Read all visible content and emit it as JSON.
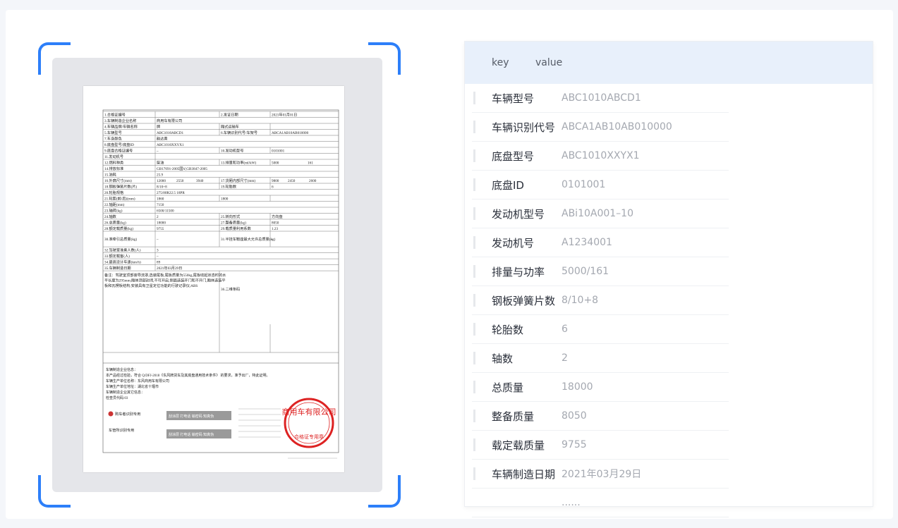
{
  "panel": {
    "header": {
      "key": "key",
      "value": "value"
    },
    "rows": [
      {
        "key": "车辆型号",
        "value": "ABC1010ABCD1"
      },
      {
        "key": "车辆识别代号",
        "value": "ABCA1AB10AB010000"
      },
      {
        "key": "底盘型号",
        "value": "ABC1010XXYX1"
      },
      {
        "key": "底盘ID",
        "value": "0101001"
      },
      {
        "key": "发动机型号",
        "value": "ABi10A001–10"
      },
      {
        "key": "发动机号",
        "value": "A1234001"
      },
      {
        "key": "排量与功率",
        "value": "5000/161"
      },
      {
        "key": "钢板弹簧片数",
        "value": "8/10+8"
      },
      {
        "key": "轮胎数",
        "value": "6"
      },
      {
        "key": "轴数",
        "value": "2"
      },
      {
        "key": "总质量",
        "value": "18000"
      },
      {
        "key": "整备质量",
        "value": "8050"
      },
      {
        "key": "载定载质量",
        "value": "9755"
      },
      {
        "key": "车辆制造日期",
        "value": "2021年03月29日"
      },
      {
        "key": "",
        "value": "......"
      }
    ]
  },
  "document": {
    "cells": {
      "r1a": "1.合格证编号",
      "r1c": "2.发证日期",
      "r1d": "2021年01月01日",
      "r2a": "3.车辆制造企业名称",
      "r2b": "商用车有限公司",
      "r3a": "4.车辆品牌/车辆名称",
      "r3b": "牌",
      "r3c": "厢式运输车",
      "r4a": "5.车辆型号",
      "r4b": "ABC1010ABCD1",
      "r4c": "6.车辆识别代号/车架号",
      "r4d": "ABCA1AB10AB010000",
      "r5a": "7.车身颜色",
      "r5b": "韵达黄",
      "r6a": "8.底盘型号/底盘ID",
      "r6b": "ABC1010XXYX1",
      "r7a": "9.底盘合格证编号",
      "r7b": "–",
      "r7c": "10.发动机型号",
      "r7d": "0101001",
      "r8a": "11.发动机号",
      "r9a": "12.燃料种类",
      "r9b": "柴油",
      "r9c": "13.排量和功率(ml/kW)",
      "r9d": "5000",
      "r9e": "161",
      "r10a": "14.排放标准",
      "r10b": "GB17691-2005国Ⅴ,GB3847-2005",
      "r11a": "15.油耗",
      "r11b": "25.9",
      "r12a": "16.外廓尺寸(mm)",
      "r12b": "12000",
      "r12c": "2550",
      "r12d": "3940",
      "r12e": "17.货厢内部尺寸(mm)",
      "r12f": "9800",
      "r12g": "2450",
      "r12h": "2600",
      "r13a": "18.钢板弹簧片数(片)",
      "r13b": "8/10+8",
      "r13c": "19.轮胎数",
      "r13d": "6",
      "r14a": "20.轮胎规格",
      "r14b": "275/80R22.5 18PR",
      "r15a": "21.轮距(前/后)(mm)",
      "r15b": "1860",
      "r15c": "1800",
      "r16a": "22.轴距(mm)",
      "r16b": "7150",
      "r17a": "23.轴荷(kg)",
      "r17b": "6500/11500",
      "r18a": "24.轴数",
      "r18b": "2",
      "r18c": "25.转向形式",
      "r18d": "方向盘",
      "r19a": "26.总质量(kg)",
      "r19b": "18000",
      "r19c": "27.整备质量(kg)",
      "r19d": "8050",
      "r20a": "28.额定载质量(kg)",
      "r20b": "9755",
      "r20c": "29.载质量利用系数",
      "r20d": "1.23",
      "r21a": "30.准牵引总质量(kg)",
      "r21b": "–",
      "r21c": "31.半挂车鞍座最大允许总质量(kg)",
      "r21d": "–",
      "r22a": "32.驾驶室准乘人数(人)",
      "r22b": "3",
      "r23a": "33.额定载客(人)",
      "r23b": "–",
      "r24a": "34.最高设计车速(km/h)",
      "r24b": "89",
      "r25a": "35.车辆制造日期",
      "r25b": "2021年03月29日",
      "r26a": "备注：驾驶室顶部装导流罩,选装尾板,尾板质量为550kg,尾板收起状态时的水平长度为295mm;厢体顶部封闭,不可开启,侧面选装开门和不开门,厢体选装平板和瓦楞板结构;安装具有卫星定位功能的行驶记录仪;ABS",
      "r26c": "36.二维条码"
    },
    "footer_lines": [
      "车辆制造企业信息：",
      "本产品经过检验，符合 Q/DFJ-2018《东风牌货车及其底盘通用技术条件》 的要求，准予出厂，特此证明。",
      "车辆生产单位名称：东风商用车有限公司",
      "车辆生产单位地址：湖北省十堰市",
      "车辆制造企业其它信息：",
      "检查员代码:03"
    ],
    "stamp_top": "商用车有限公司",
    "stamp_bottom": "合格证专用章",
    "purchaser_label": "购车者识别专用",
    "vehicle_mgmt_label": "车管所识别专用",
    "anti_fake_text": "刮涂层 打电话 输密码 知真伪"
  }
}
